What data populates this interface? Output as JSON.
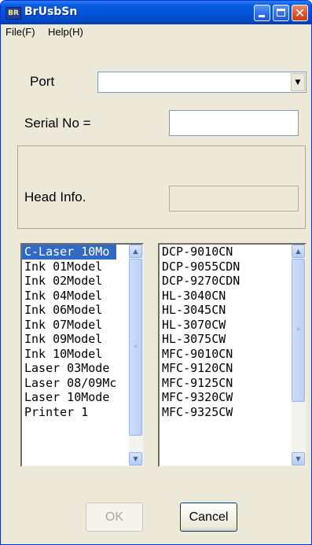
{
  "window": {
    "title": "BrUsbSn",
    "icon_label": "BR",
    "controls": {
      "minimize": "minimize-icon",
      "maximize": "maximize-icon",
      "close": "close-icon"
    }
  },
  "menu": [
    {
      "label": "File(F)"
    },
    {
      "label": "Help(H)"
    }
  ],
  "form": {
    "port_label": "Port",
    "port_value": "",
    "serial_label": "Serial No =",
    "serial_value": "",
    "head_label": "Head Info.",
    "head_value": ""
  },
  "left_list": {
    "selected_index": 0,
    "items": [
      "C-Laser 10Mo",
      "Ink 01Model",
      "Ink 02Model",
      "Ink 04Model",
      "Ink 06Model",
      "Ink 07Model",
      "Ink 09Model",
      "Ink 10Model",
      "Laser 03Mode",
      "Laser 08/09Mc",
      "Laser 10Mode",
      "Printer 1"
    ]
  },
  "right_list": {
    "items": [
      "DCP-9010CN",
      "DCP-9055CDN",
      "DCP-9270CDN",
      "HL-3040CN",
      "HL-3045CN",
      "HL-3070CW",
      "HL-3075CW",
      "MFC-9010CN",
      "MFC-9120CN",
      "MFC-9125CN",
      "MFC-9320CW",
      "MFC-9325CW"
    ]
  },
  "buttons": {
    "ok": "OK",
    "cancel": "Cancel"
  },
  "colors": {
    "titlebar": "#0352d9",
    "selection": "#316ac5",
    "face": "#ece9d8"
  }
}
